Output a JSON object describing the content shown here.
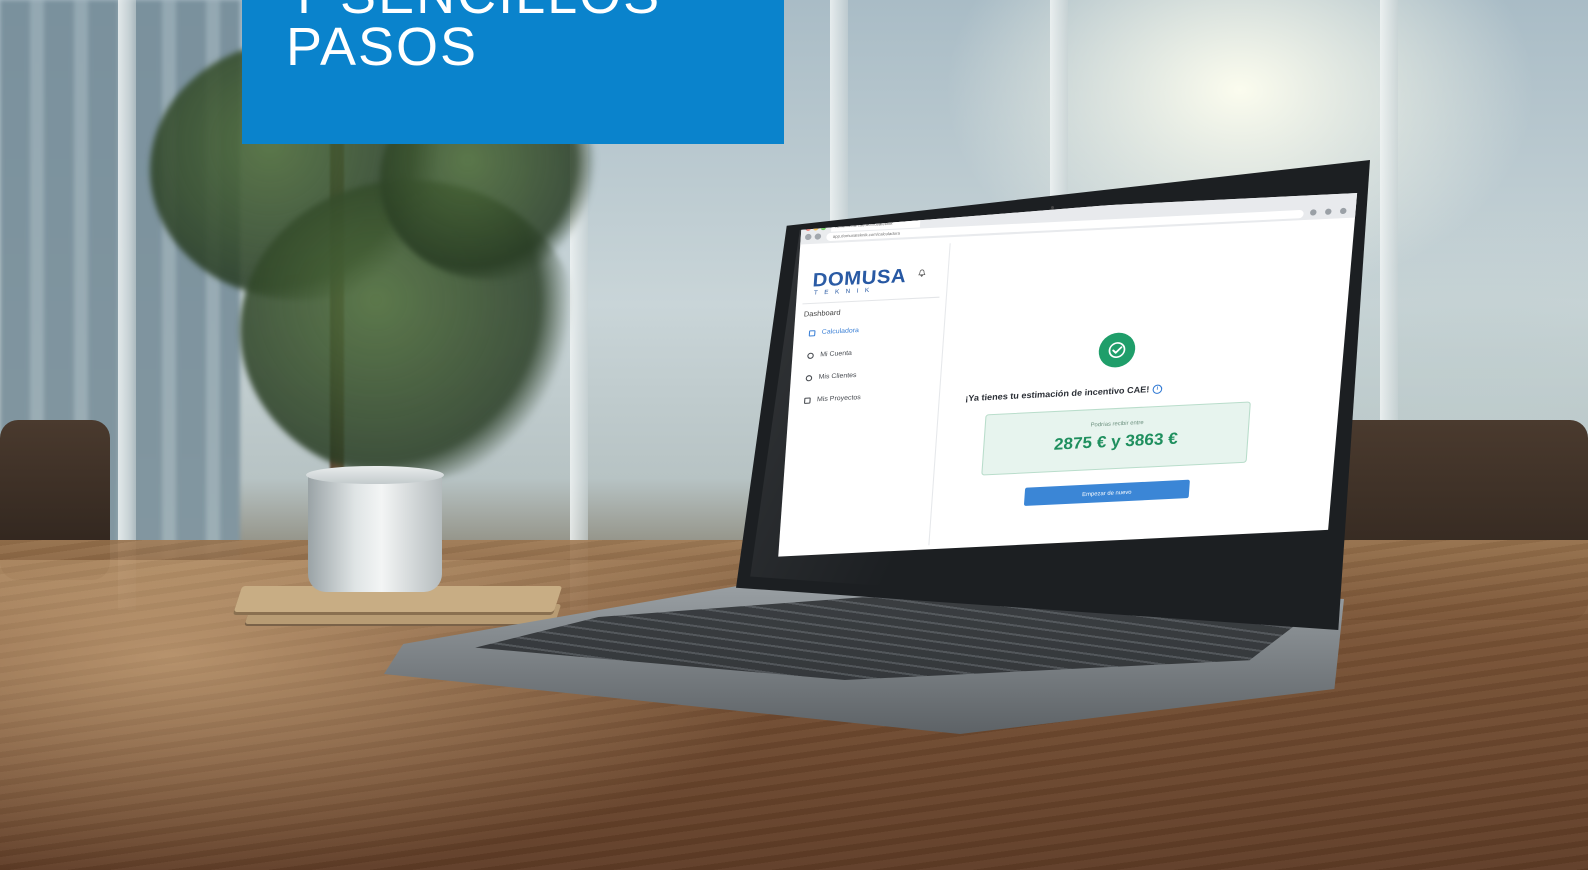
{
  "headline": {
    "line1": "Y SENCILLOS",
    "line2": "PASOS"
  },
  "browser": {
    "tab_title": "calculadora-cae.domusateknik",
    "address": "app.domusateknik.com/calculadora"
  },
  "app": {
    "brand": "DOMUSA",
    "brand_sub": "TEKNIK",
    "sidebar": {
      "section_label": "Dashboard",
      "items": [
        {
          "label": "Calculadora",
          "icon": "calculator-icon",
          "active": true
        },
        {
          "label": "Mi Cuenta",
          "icon": "user-icon",
          "active": false
        },
        {
          "label": "Mis Clientes",
          "icon": "users-icon",
          "active": false
        },
        {
          "label": "Mis Proyectos",
          "icon": "folder-icon",
          "active": false
        }
      ]
    },
    "result": {
      "title": "¡Ya tienes tu estimación de incentivo CAE!",
      "label": "Podrías recibir entre",
      "value": "2875 € y 3863 €",
      "button": "Empezar de nuevo"
    }
  },
  "colors": {
    "title_block": "#0a83cc",
    "brand": "#1b4f9e",
    "success": "#1f9e6a",
    "result_bg": "#e7f4ee",
    "button": "#3b86d6"
  }
}
